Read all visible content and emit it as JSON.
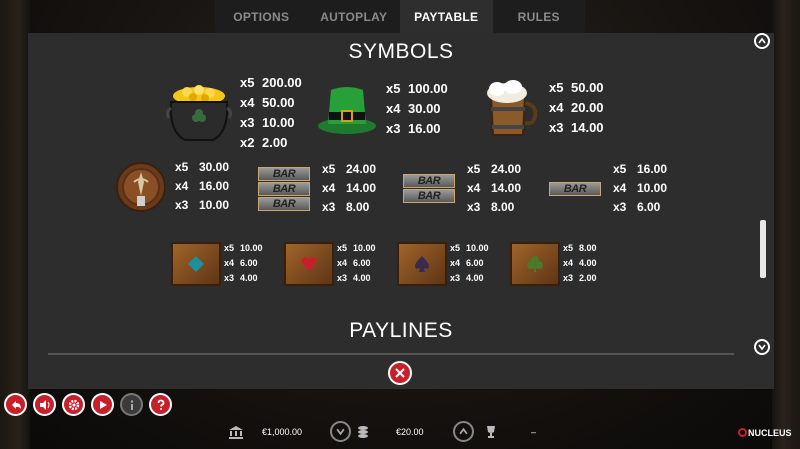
{
  "tabs": [
    {
      "label": "OPTIONS",
      "active": false
    },
    {
      "label": "AUTOPLAY",
      "active": false
    },
    {
      "label": "PAYTABLE",
      "active": true
    },
    {
      "label": "RULES",
      "active": false
    }
  ],
  "paytable": {
    "symbols_title": "SYMBOLS",
    "paylines_title": "PAYLINES",
    "symbols": [
      {
        "name": "pot-of-gold",
        "pays": [
          [
            "x5",
            "200.00"
          ],
          [
            "x4",
            "50.00"
          ],
          [
            "x3",
            "10.00"
          ],
          [
            "x2",
            "2.00"
          ]
        ]
      },
      {
        "name": "green-hat",
        "pays": [
          [
            "x5",
            "100.00"
          ],
          [
            "x4",
            "30.00"
          ],
          [
            "x3",
            "16.00"
          ]
        ]
      },
      {
        "name": "beer-mug",
        "pays": [
          [
            "x5",
            "50.00"
          ],
          [
            "x4",
            "20.00"
          ],
          [
            "x3",
            "14.00"
          ]
        ]
      },
      {
        "name": "barrel",
        "pays": [
          [
            "x5",
            "30.00"
          ],
          [
            "x4",
            "16.00"
          ],
          [
            "x3",
            "10.00"
          ]
        ]
      },
      {
        "name": "triple-bar",
        "pays": [
          [
            "x5",
            "24.00"
          ],
          [
            "x4",
            "14.00"
          ],
          [
            "x3",
            "8.00"
          ]
        ]
      },
      {
        "name": "double-bar",
        "pays": [
          [
            "x5",
            "24.00"
          ],
          [
            "x4",
            "14.00"
          ],
          [
            "x3",
            "8.00"
          ]
        ]
      },
      {
        "name": "single-bar",
        "pays": [
          [
            "x5",
            "16.00"
          ],
          [
            "x4",
            "10.00"
          ],
          [
            "x3",
            "6.00"
          ]
        ]
      },
      {
        "name": "diamond",
        "pays": [
          [
            "x5",
            "10.00"
          ],
          [
            "x4",
            "6.00"
          ],
          [
            "x3",
            "4.00"
          ]
        ]
      },
      {
        "name": "heart",
        "pays": [
          [
            "x5",
            "10.00"
          ],
          [
            "x4",
            "6.00"
          ],
          [
            "x3",
            "4.00"
          ]
        ]
      },
      {
        "name": "spade",
        "pays": [
          [
            "x5",
            "10.00"
          ],
          [
            "x4",
            "6.00"
          ],
          [
            "x3",
            "4.00"
          ]
        ]
      },
      {
        "name": "club",
        "pays": [
          [
            "x5",
            "8.00"
          ],
          [
            "x4",
            "4.00"
          ],
          [
            "x3",
            "2.00"
          ]
        ]
      }
    ],
    "bar_text": "BAR"
  },
  "footer": {
    "balance": "€1,000.00",
    "bet": "€20.00",
    "win": "–",
    "brand": "NUCLEUS"
  },
  "colors": {
    "accent": "#c8202a",
    "panel": "#2d2d2d",
    "tab_bar": "#1d1d1d"
  }
}
